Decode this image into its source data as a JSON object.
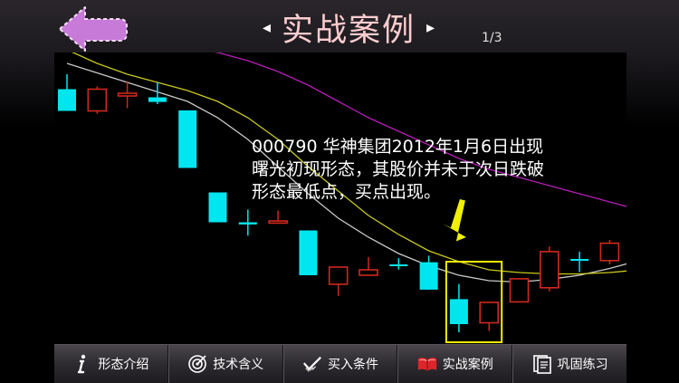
{
  "header": {
    "title": "实战案例",
    "prev_label": "◂",
    "next_label": "▸",
    "page_indicator": "1/3"
  },
  "annotation": {
    "lines": [
      "000790 华神集团2012年1月6日出现",
      "曙光初现形态，其股价并未于次日跌破",
      "形态最低点，买点出现。"
    ]
  },
  "toolbar": {
    "items": [
      {
        "label": "形态介绍",
        "icon": "info-icon"
      },
      {
        "label": "技术含义",
        "icon": "target-icon"
      },
      {
        "label": "买入条件",
        "icon": "buy-checkmark-icon"
      },
      {
        "label": "实战案例",
        "icon": "book-icon"
      },
      {
        "label": "巩固练习",
        "icon": "notes-icon"
      }
    ]
  },
  "colors": {
    "up_candle": "#d0281e",
    "down_candle": "#00e6f0",
    "ma_white": "#c8c8c8",
    "ma_yellow": "#c8c81e",
    "ma_purple": "#b41eb4",
    "highlight": "#f0f000",
    "back_arrow": "#c87ad8",
    "title": "#ffcdd0"
  },
  "chart_data": {
    "type": "candlestick",
    "up_color": "red",
    "down_color": "cyan",
    "candles": [
      {
        "o": 0.905,
        "c": 0.825,
        "h": 0.96,
        "l": 0.825
      },
      {
        "o": 0.825,
        "c": 0.905,
        "h": 0.915,
        "l": 0.815
      },
      {
        "o": 0.88,
        "c": 0.89,
        "h": 0.935,
        "l": 0.835
      },
      {
        "o": 0.875,
        "c": 0.858,
        "h": 0.93,
        "l": 0.85
      },
      {
        "o": 0.827,
        "c": 0.615,
        "h": 0.827,
        "l": 0.615
      },
      {
        "o": 0.525,
        "c": 0.415,
        "h": 0.525,
        "l": 0.415
      },
      {
        "o": 0.415,
        "c": 0.407,
        "h": 0.462,
        "l": 0.366
      },
      {
        "o": 0.412,
        "c": 0.42,
        "h": 0.458,
        "l": 0.412
      },
      {
        "o": 0.385,
        "c": 0.22,
        "h": 0.385,
        "l": 0.22
      },
      {
        "o": 0.187,
        "c": 0.25,
        "h": 0.25,
        "l": 0.144
      },
      {
        "o": 0.22,
        "c": 0.24,
        "h": 0.287,
        "l": 0.22
      },
      {
        "o": 0.26,
        "c": 0.255,
        "h": 0.283,
        "l": 0.241
      },
      {
        "o": 0.268,
        "c": 0.167,
        "h": 0.292,
        "l": 0.167
      },
      {
        "o": 0.132,
        "c": 0.04,
        "h": 0.188,
        "l": 0.01
      },
      {
        "o": 0.045,
        "c": 0.12,
        "h": 0.12,
        "l": 0.015
      },
      {
        "o": 0.122,
        "c": 0.207,
        "h": 0.207,
        "l": 0.122
      },
      {
        "o": 0.174,
        "c": 0.307,
        "h": 0.326,
        "l": 0.161
      },
      {
        "o": 0.28,
        "c": 0.28,
        "h": 0.307,
        "l": 0.232
      },
      {
        "o": 0.274,
        "c": 0.338,
        "h": 0.35,
        "l": 0.26
      },
      {
        "o": 0.27,
        "c": 0.36,
        "h": 0.415,
        "l": 0.26
      }
    ],
    "moving_averages": [
      {
        "color": "white",
        "values": [
          1.0,
          0.965,
          0.93,
          0.895,
          0.86,
          0.8,
          0.72,
          0.62,
          0.52,
          0.43,
          0.36,
          0.3,
          0.255,
          0.22,
          0.2,
          0.195,
          0.205,
          0.22,
          0.245,
          0.275
        ]
      },
      {
        "color": "yellow",
        "values": [
          1.05,
          1.0,
          0.96,
          0.93,
          0.9,
          0.86,
          0.8,
          0.72,
          0.62,
          0.53,
          0.44,
          0.37,
          0.31,
          0.27,
          0.24,
          0.23,
          0.225,
          0.225,
          0.23,
          0.24
        ]
      },
      {
        "color": "purple",
        "values": [
          1.1,
          1.09,
          1.08,
          1.07,
          1.06,
          1.04,
          1.01,
          0.97,
          0.92,
          0.86,
          0.8,
          0.75,
          0.7,
          0.65,
          0.61,
          0.58,
          0.55,
          0.52,
          0.49,
          0.46
        ]
      }
    ],
    "highlight_range": [
      13,
      14
    ]
  }
}
